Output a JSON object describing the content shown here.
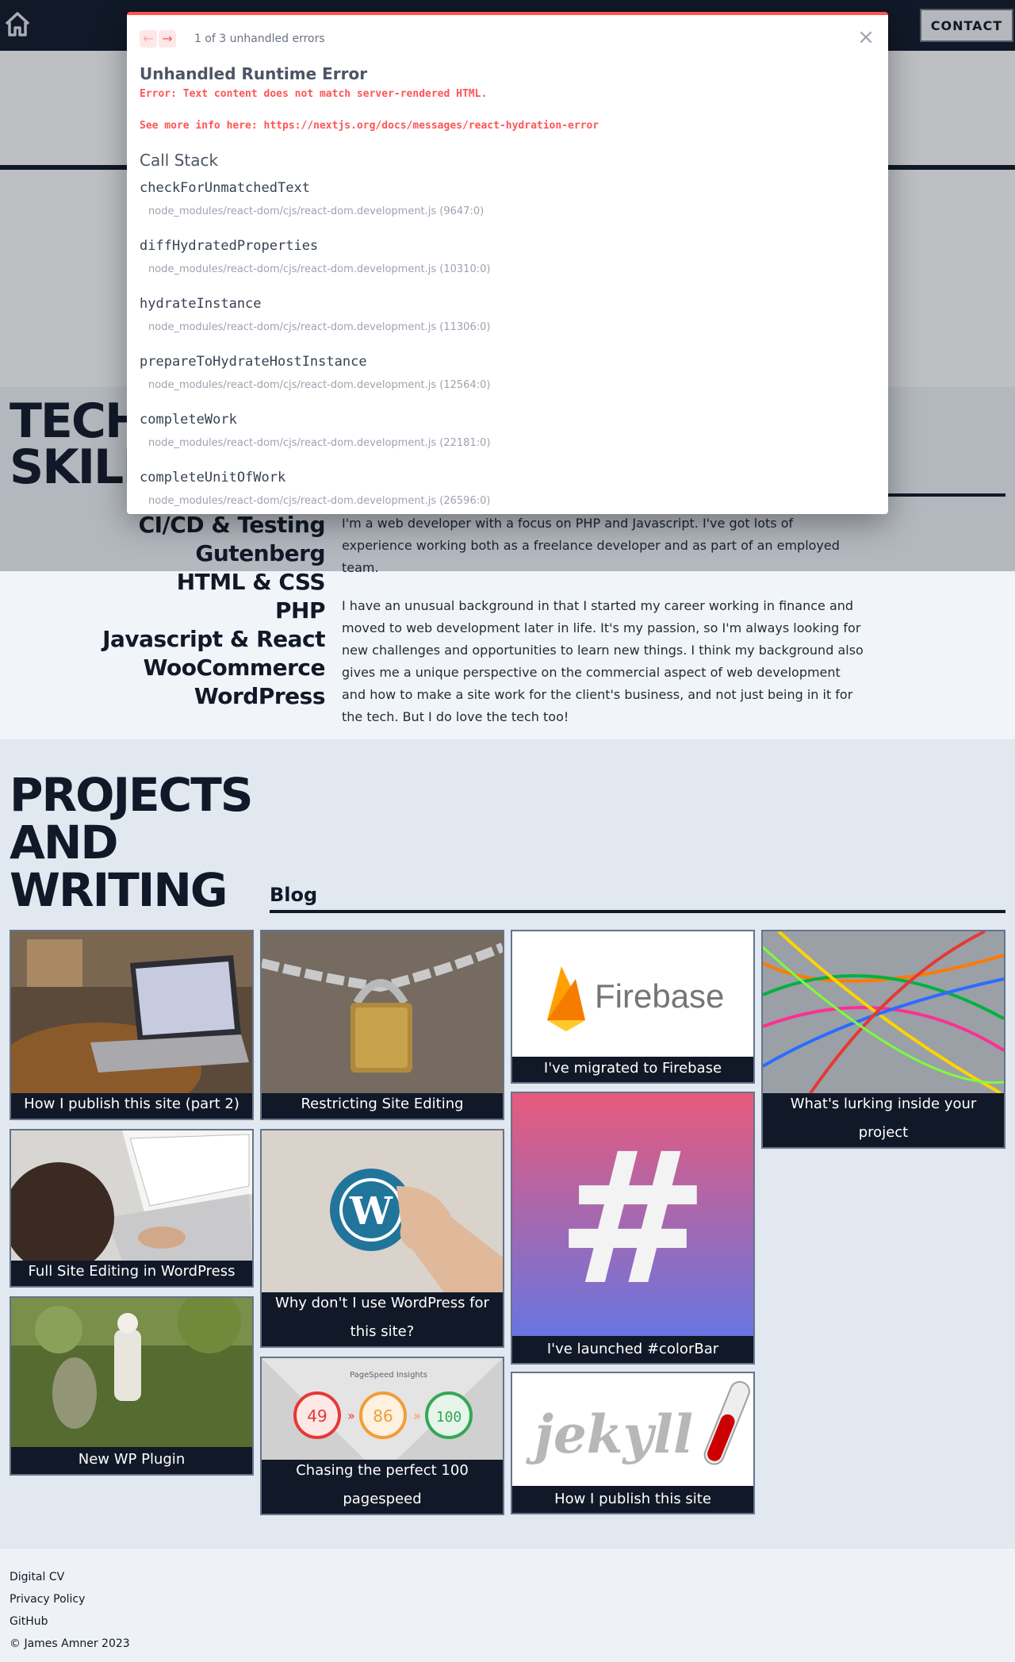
{
  "header": {
    "contact_label": "CONTACT"
  },
  "about": {
    "heading": "TECH\nSKILLS",
    "skills": [
      "CI/CD & Testing",
      "Gutenberg",
      "HTML & CSS",
      "PHP",
      "Javascript & React",
      "WooCommerce",
      "WordPress"
    ],
    "paragraphs": [
      "I'm a web developer with a focus on PHP and Javascript. I've got lots of experience working both as a freelance developer and as part of an employed team.",
      "I have an unusual background in that I started my career working in finance and moved to web development later in life. It's my passion, so I'm always looking for new challenges and opportunities to learn new things. I think my background also gives me a unique perspective on the commercial aspect of web development and how to make a site work for the client's business, and not just being in it for the tech. But I do love the tech too!"
    ]
  },
  "projects": {
    "heading": "PROJECTS\nAND\nWRITING",
    "blog_label": "Blog",
    "cards": [
      {
        "title": "How I publish this site (part 2)",
        "icon": "laptop-photo"
      },
      {
        "title": "Full Site Editing in WordPress",
        "icon": "typing-photo"
      },
      {
        "title": "New WP Plugin",
        "icon": "butterfly-net-photo"
      },
      {
        "title": "Restricting Site Editing",
        "icon": "padlock-photo"
      },
      {
        "title": "Why don't I use WordPress for this site?",
        "icon": "wordpress-logo-photo"
      },
      {
        "title": "Chasing the perfect 100 pagespeed",
        "icon": "pagespeed-scores",
        "pagespeed": {
          "label": "PageSpeed Insights",
          "scores": [
            "49",
            "86",
            "100"
          ]
        }
      },
      {
        "title": "I've migrated to Firebase",
        "icon": "firebase-logo",
        "logo_text": "Firebase"
      },
      {
        "title": "I've launched #colorBar",
        "icon": "hash-gradient",
        "glyph": "#"
      },
      {
        "title": "How I publish this site",
        "icon": "jekyll-logo",
        "logo_text": "jekyll"
      },
      {
        "title": "What's lurking inside your project",
        "icon": "patch-cables-photo"
      }
    ]
  },
  "footer": {
    "links": [
      "Digital CV",
      "Privacy Policy",
      "GitHub"
    ],
    "copyright": "© James Amner 2023"
  },
  "error_dialog": {
    "prev_glyph": "←",
    "next_glyph": "→",
    "count": "1 of 3 unhandled errors",
    "close_glyph": "×",
    "title": "Unhandled Runtime Error",
    "message": "Error: Text content does not match server-rendered HTML.",
    "info": "See more info here: https://nextjs.org/docs/messages/react-hydration-error",
    "call_stack_label": "Call Stack",
    "frames": [
      {
        "fn": "checkForUnmatchedText",
        "file": "node_modules/react-dom/cjs/react-dom.development.js (9647:0)"
      },
      {
        "fn": "diffHydratedProperties",
        "file": "node_modules/react-dom/cjs/react-dom.development.js (10310:0)"
      },
      {
        "fn": "hydrateInstance",
        "file": "node_modules/react-dom/cjs/react-dom.development.js (11306:0)"
      },
      {
        "fn": "prepareToHydrateHostInstance",
        "file": "node_modules/react-dom/cjs/react-dom.development.js (12564:0)"
      },
      {
        "fn": "completeWork",
        "file": "node_modules/react-dom/cjs/react-dom.development.js (22181:0)"
      },
      {
        "fn": "completeUnitOfWork",
        "file": "node_modules/react-dom/cjs/react-dom.development.js (26596:0)"
      }
    ]
  }
}
